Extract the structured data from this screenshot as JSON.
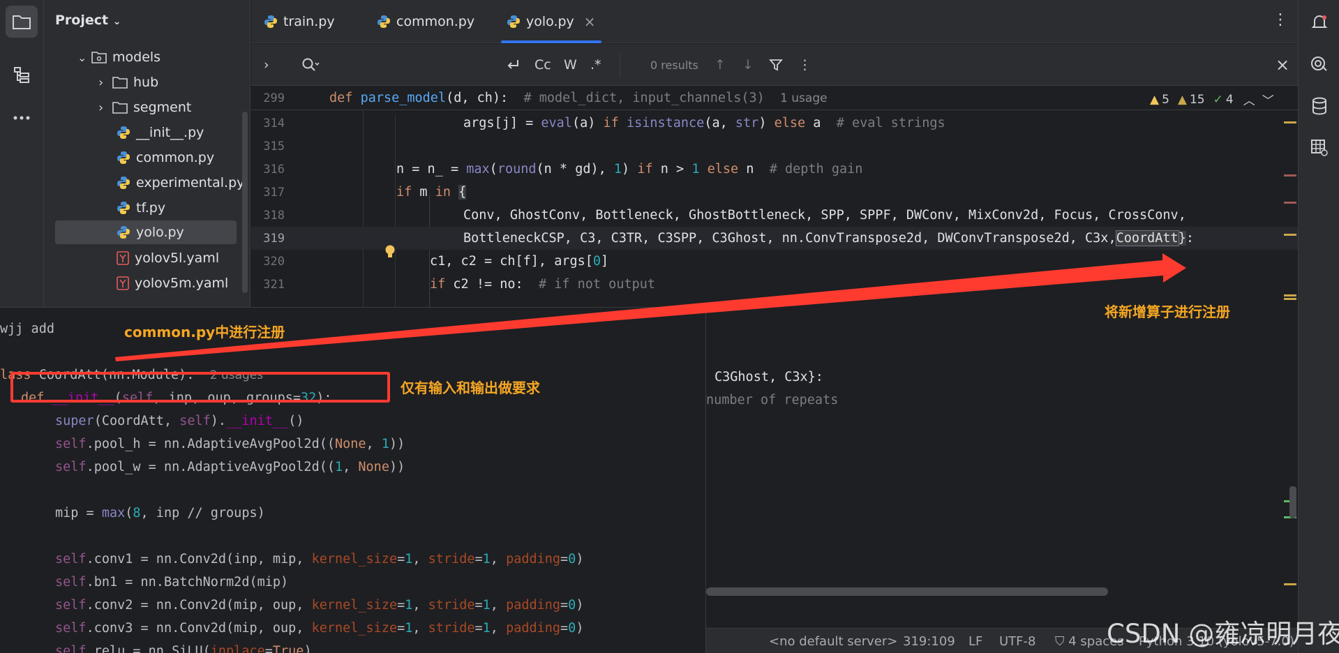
{
  "window": {
    "project_label": "Project"
  },
  "tree": [
    {
      "label": "models",
      "type": "folder-open"
    },
    {
      "label": "hub",
      "type": "folder"
    },
    {
      "label": "segment",
      "type": "folder"
    },
    {
      "label": "__init__.py",
      "type": "python"
    },
    {
      "label": "common.py",
      "type": "python"
    },
    {
      "label": "experimental.py",
      "type": "python"
    },
    {
      "label": "tf.py",
      "type": "python"
    },
    {
      "label": "yolo.py",
      "type": "python",
      "selected": true
    },
    {
      "label": "yolov5l.yaml",
      "type": "yaml"
    },
    {
      "label": "yolov5m.yaml",
      "type": "yaml"
    }
  ],
  "tabs": [
    {
      "label": "train.py",
      "active": false
    },
    {
      "label": "common.py",
      "active": false
    },
    {
      "label": "yolo.py",
      "active": true,
      "close": "×"
    }
  ],
  "find": {
    "case_label": "Cc",
    "word_label": "W",
    "regex_label": ".*",
    "results": "0 results"
  },
  "sticky": {
    "line": "299",
    "usage": "1 usage"
  },
  "inspections": {
    "warnings": "5",
    "weak": "15",
    "typos": "4"
  },
  "editor_lines": [
    {
      "n": "314"
    },
    {
      "n": "315"
    },
    {
      "n": "316"
    },
    {
      "n": "317"
    },
    {
      "n": "318"
    },
    {
      "n": "319"
    },
    {
      "n": "320"
    },
    {
      "n": "321"
    }
  ],
  "bg_text": {
    "line_c3ghost": "C3Ghost, C3x}:",
    "line_repeats": "number of repeats"
  },
  "overlay": {
    "comment": "wjj add",
    "usage": "2 usages"
  },
  "annotations": {
    "common": "common.py中进行注册",
    "inout": "仅有输入和输出做要求",
    "register": "将新增算子进行注册"
  },
  "status": {
    "server": "<no default server>",
    "pos": "319:109",
    "lf": "LF",
    "enc": "UTF-8",
    "indent": "4 spaces",
    "interp": "Python 3.10 (yolov5-7.0)"
  },
  "watermark": "CSDN @雍凉明月夜",
  "colors": {
    "accent": "#3574f0",
    "annotation": "#f5a623",
    "arrow": "#ff3b30",
    "box": "#ff3b30"
  }
}
